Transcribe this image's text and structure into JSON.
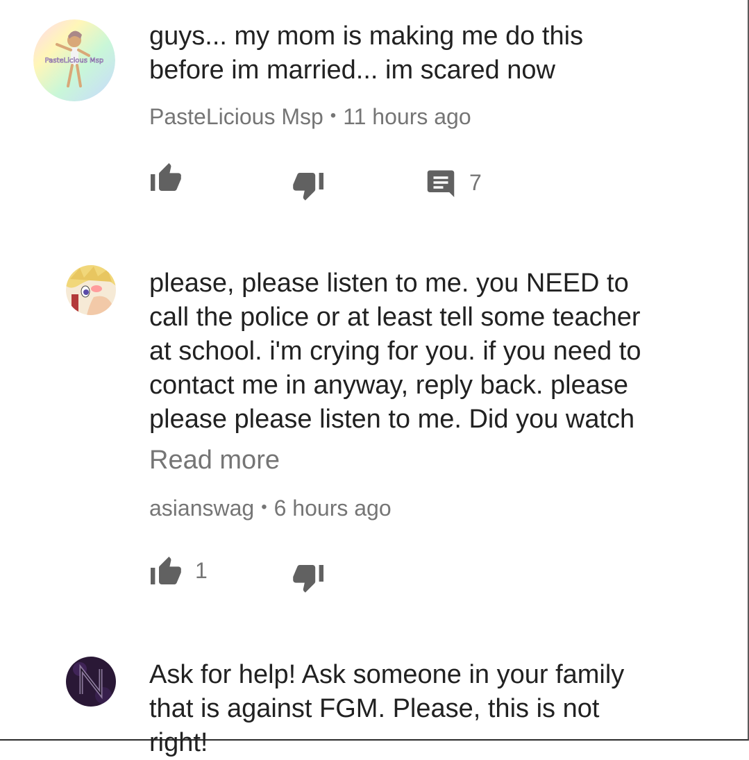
{
  "comments": [
    {
      "text": "guys... my mom is making me do this\nbefore im married... im scared now",
      "author": "PasteLicious Msp",
      "separator": "•",
      "time": "11 hours ago",
      "avatar_text": "PasteLicious Msp",
      "avatar_icon": "pastelicious-avatar",
      "like_count": "",
      "reply_count": "7"
    },
    {
      "text": "please, please listen to me. you NEED to\ncall the police or at least tell some teacher\nat school. i'm crying for you. if you need to\ncontact me in anyway, reply back. please\nplease please listen to me. Did you watch",
      "read_more": "Read more",
      "author": "asianswag",
      "separator": "•",
      "time": "6 hours ago",
      "avatar_icon": "anime-avatar",
      "like_count": "1"
    },
    {
      "text": "Ask for help! Ask someone in your family\nthat is against FGM. Please, this is not\nright!",
      "avatar_icon": "dark-n-logo-avatar"
    }
  ],
  "icons": {
    "like": "thumbs-up-icon",
    "dislike": "thumbs-down-icon",
    "reply": "comment-icon"
  },
  "colors": {
    "text": "#212121",
    "secondary": "#757575",
    "icon": "#616161"
  }
}
